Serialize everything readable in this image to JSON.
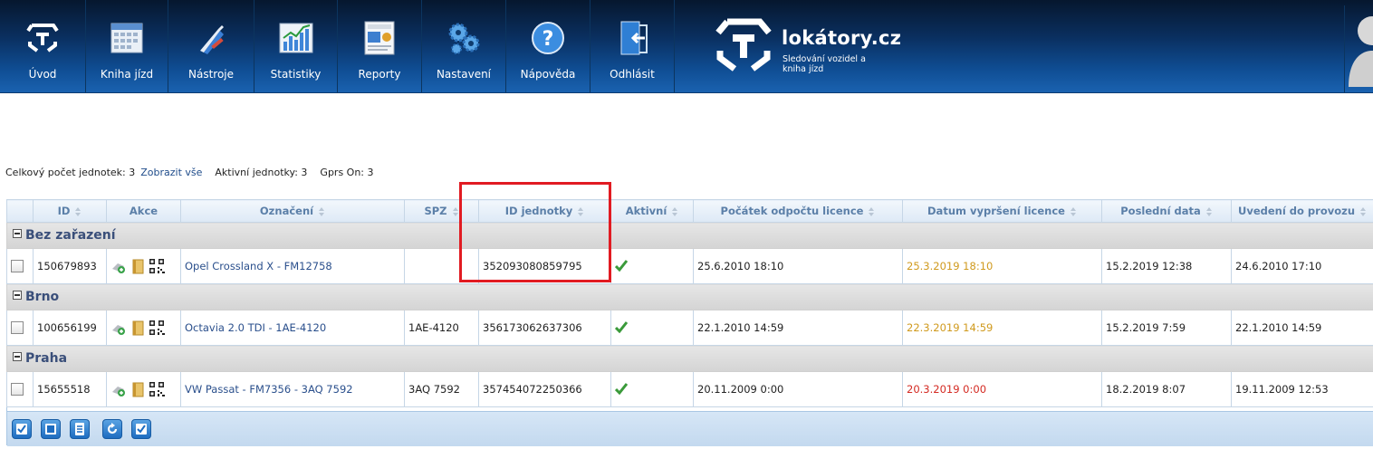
{
  "nav": {
    "items": [
      {
        "label": "Úvod",
        "icon": "home-icon"
      },
      {
        "label": "Kniha jízd",
        "icon": "calendar-icon"
      },
      {
        "label": "Nástroje",
        "icon": "tools-icon"
      },
      {
        "label": "Statistiky",
        "icon": "statistics-icon"
      },
      {
        "label": "Reporty",
        "icon": "report-icon"
      },
      {
        "label": "Nastavení",
        "icon": "gears-icon"
      },
      {
        "label": "Nápověda",
        "icon": "help-icon"
      },
      {
        "label": "Odhlásit",
        "icon": "logout-icon"
      }
    ],
    "brand_name": "lokátory.cz",
    "brand_tagline": "Sledování vozidel a kniha jízd"
  },
  "summary": {
    "total_label": "Celkový počet jednotek: 3",
    "show_all": "Zobrazit vše",
    "active_label": "Aktivní jednotky: 3",
    "gprs_label": "Gprs On: 3"
  },
  "table": {
    "headers": [
      "ID",
      "Akce",
      "Označení",
      "SPZ",
      "ID jednotky",
      "Aktivní",
      "Počátek odpočtu licence",
      "Datum vypršení licence",
      "Poslední data",
      "Uvedení do provozu"
    ],
    "groups": [
      {
        "name": "Bez zařazení",
        "row": {
          "id": "150679893",
          "oznaceni": "Opel Crossland X - FM12758",
          "spz": "",
          "id_jednotky": "352093080859795",
          "pocatek": "25.6.2010 18:10",
          "vyprseni": "25.3.2019 18:10",
          "vyprseni_status": "warning",
          "posledni": "15.2.2019 12:38",
          "uvedeni": "24.6.2010 17:10"
        }
      },
      {
        "name": "Brno",
        "row": {
          "id": "100656199",
          "oznaceni": "Octavia 2.0 TDI - 1AE-4120",
          "spz": "1AE-4120",
          "id_jednotky": "356173062637306",
          "pocatek": "22.1.2010 14:59",
          "vyprseni": "22.3.2019 14:59",
          "vyprseni_status": "warning",
          "posledni": "15.2.2019 7:59",
          "uvedeni": "22.1.2010 14:59"
        }
      },
      {
        "name": "Praha",
        "row": {
          "id": "15655518",
          "oznaceni": "VW Passat - FM7356 - 3AQ 7592",
          "spz": "3AQ 7592",
          "id_jednotky": "357454072250366",
          "pocatek": "20.11.2009 0:00",
          "vyprseni": "20.3.2019 0:00",
          "vyprseni_status": "expired",
          "posledni": "18.2.2019 8:07",
          "uvedeni": "19.11.2009 12:53"
        }
      }
    ]
  },
  "colors": {
    "warning": "#d09a1e",
    "expired": "#d42a22",
    "highlight": "#e11b22",
    "header_bar": "#0f4d93"
  }
}
